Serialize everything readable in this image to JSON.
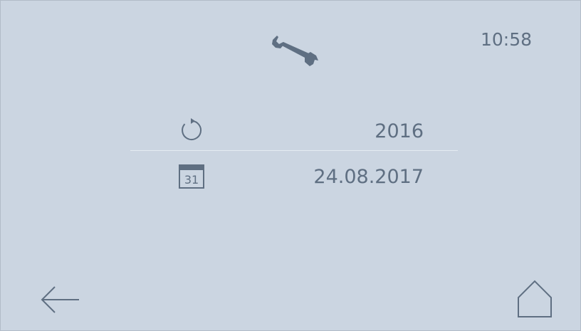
{
  "header": {
    "time": "10:58",
    "page_icon": "wrench-icon"
  },
  "rows": [
    {
      "icon": "refresh-icon",
      "value": "2016"
    },
    {
      "icon": "calendar-icon",
      "icon_text": "31",
      "value": "24.08.2017"
    }
  ],
  "footer": {
    "back_icon": "arrow-left-icon",
    "home_icon": "home-icon"
  },
  "colors": {
    "background": "#cbd5e1",
    "foreground": "#5f6f82",
    "divider": "#e5ebf2"
  }
}
